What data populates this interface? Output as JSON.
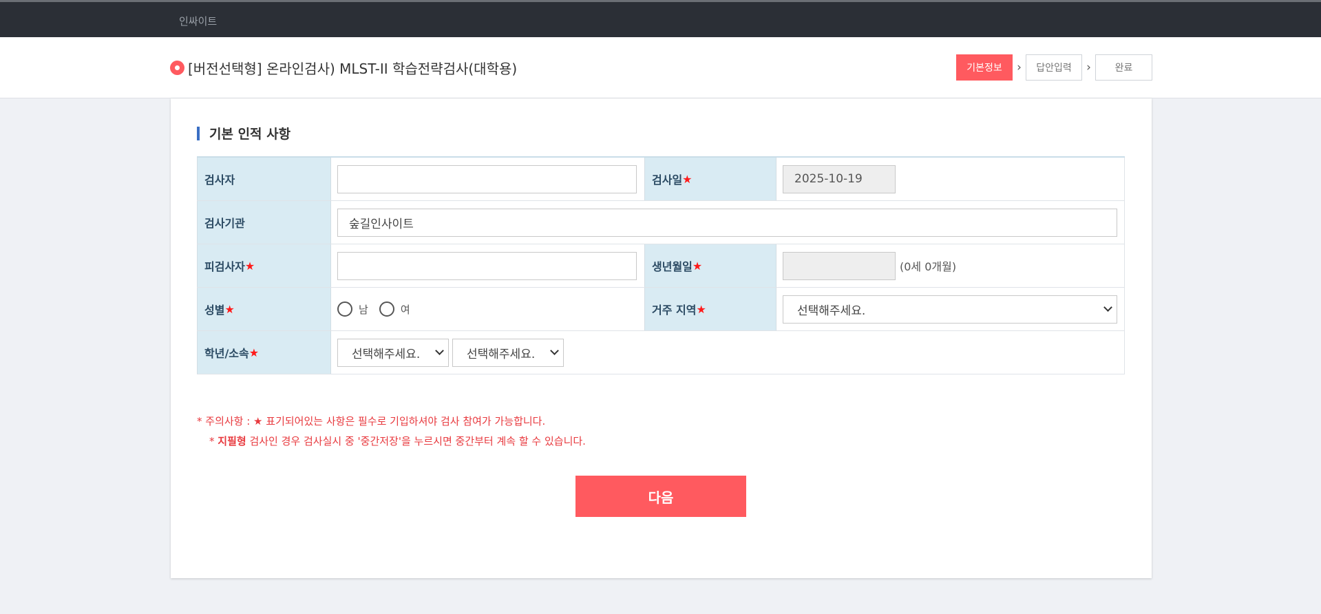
{
  "topbar": {
    "brand": "인싸이트"
  },
  "header": {
    "title": "[버전선택형]  온라인검사) MLST-II 학습전략검사(대학용)",
    "steps": [
      {
        "label": "기본정보",
        "active": true
      },
      {
        "label": "답안입력",
        "active": false
      },
      {
        "label": "완료",
        "active": false
      }
    ]
  },
  "section": {
    "title": "기본 인적 사항"
  },
  "form": {
    "examiner_label": "검사자",
    "examiner_value": "",
    "exam_date_label": "검사일",
    "exam_date_value": "2025-10-19",
    "institution_label": "검사기관",
    "institution_value": "숲길인사이트",
    "examinee_label": "피검사자",
    "examinee_value": "",
    "birth_label": "생년월일",
    "birth_value": "",
    "age_note": "(0세 0개월)",
    "gender_label": "성별",
    "gender_options": [
      "남",
      "여"
    ],
    "region_label": "거주 지역",
    "region_selected": "선택해주세요.",
    "grade_label": "학년/소속",
    "grade_selected": "선택해주세요.",
    "affiliation_selected": "선택해주세요.",
    "required_mark": "★"
  },
  "notes": {
    "line1": "* 주의사항 : ★ 표기되어있는 사항은 필수로 기입하셔야 검사 참여가 가능합니다.",
    "line2_prefix": "* ",
    "line2_bold": "지필형",
    "line2_rest": " 검사인 경우 검사실시 중 '중간저장'을 누르시면 중간부터 계속 할 수 있습니다."
  },
  "actions": {
    "next_label": "다음"
  },
  "colors": {
    "accent": "#ff5a5f",
    "topbar": "#2b2f36",
    "label_bg": "#d9ebf3",
    "section_bar": "#3a6fc4",
    "note_red": "#e8393e"
  }
}
